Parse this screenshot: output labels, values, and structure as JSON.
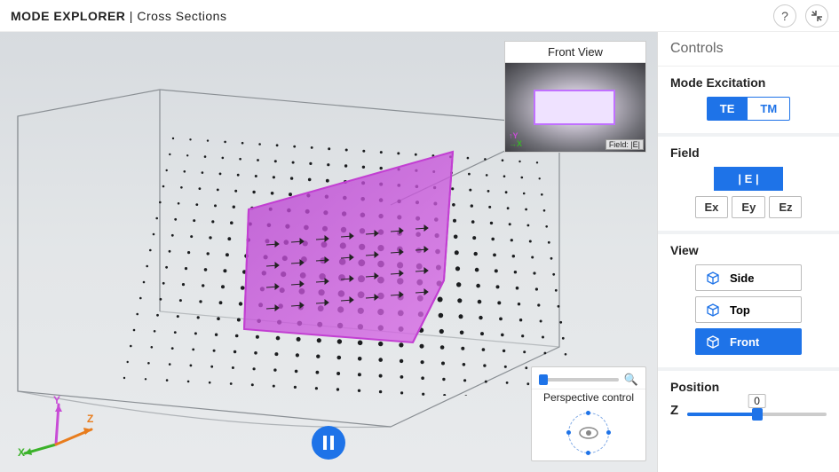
{
  "header": {
    "title": "MODE EXPLORER",
    "separator": "|",
    "subtitle": "Cross Sections"
  },
  "inset": {
    "title": "Front View",
    "field_label": "Field: |E|",
    "axis_y": "Y",
    "axis_x": "X"
  },
  "perspective": {
    "label": "Perspective control"
  },
  "sidebar": {
    "title": "Controls",
    "mode": {
      "heading": "Mode Excitation",
      "te": "TE",
      "tm": "TM",
      "active": "TE"
    },
    "field": {
      "heading": "Field",
      "mag": "| E |",
      "ex": "Ex",
      "ey": "Ey",
      "ez": "Ez",
      "active": "mag"
    },
    "view": {
      "heading": "View",
      "side": "Side",
      "top": "Top",
      "front": "Front",
      "active": "Front"
    },
    "position": {
      "heading": "Position",
      "axis": "Z",
      "value": "0",
      "percent": 50
    }
  },
  "axis3d": {
    "x": "X",
    "y": "Y",
    "z": "Z"
  },
  "colors": {
    "accent": "#1e73e8",
    "magenta": "#c23fd2",
    "axis_x": "#3bb22a",
    "axis_y": "#c84cd6",
    "axis_z": "#e87d1e"
  }
}
